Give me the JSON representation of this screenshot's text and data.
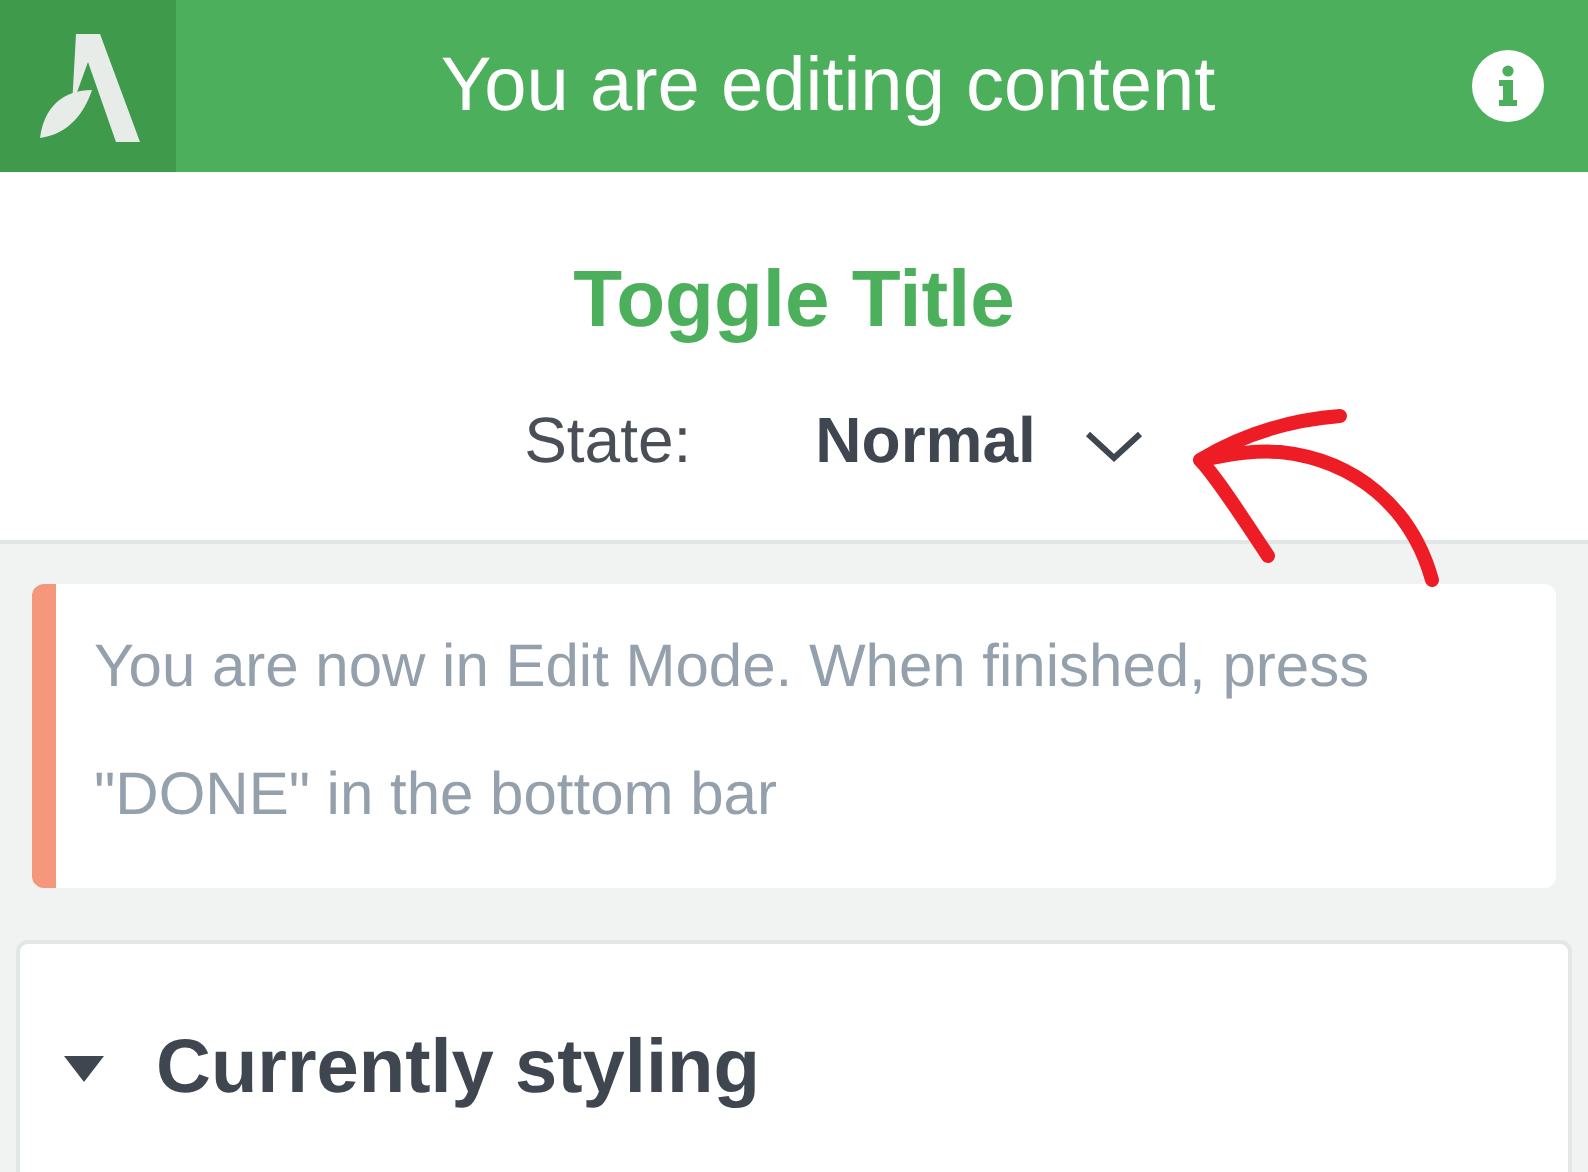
{
  "header": {
    "title": "You are editing content"
  },
  "panel": {
    "title": "Toggle Title",
    "state_label": "State:",
    "state_value": "Normal"
  },
  "notice": {
    "text": "You are now in Edit Mode. When finished, press \"DONE\" in the bottom bar"
  },
  "section": {
    "title": "Currently styling",
    "expanded": true
  }
}
